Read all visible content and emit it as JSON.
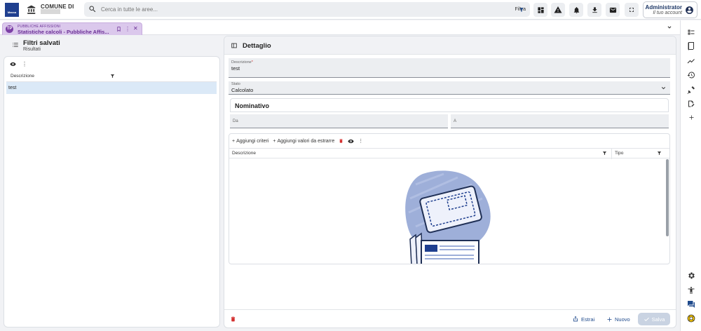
{
  "header": {
    "logo_text": "Massa",
    "comune_label": "COMUNE DI",
    "search_placeholder": "Cerca in tutte le aree...",
    "filter_label": "Filtra",
    "account_name": "Administrator",
    "account_sub": "Il tuo account"
  },
  "tab": {
    "badge": "TP",
    "category": "PUBBLICHE AFFISSIONI",
    "title": "Statistiche calcoli - Pubbliche Affis..."
  },
  "left_panel": {
    "title": "Filtri salvati",
    "subtitle": "Risultati",
    "column_header": "Descrizione",
    "rows": [
      "test"
    ]
  },
  "detail": {
    "title": "Dettaglio",
    "descrizione_label": "Descrizione",
    "required_mark": "*",
    "descrizione_value": "test",
    "stato_label": "Stato",
    "stato_value": "Calcolato",
    "nominativo_title": "Nominativo",
    "da_label": "Da",
    "a_label": "A",
    "add_criteri": "Aggiungi criteri",
    "add_valori": "Aggiungi valori da estrarre",
    "col_descrizione": "Descrizione",
    "col_tipo": "Tipo"
  },
  "footer": {
    "estrai": "Estrai",
    "nuovo": "Nuovo",
    "salva": "Salva"
  },
  "colors": {
    "accent": "#1f4a8c",
    "tab_bg": "#dbc8ec",
    "tab_text": "#6a2f95",
    "selected_row": "#dbe9f7",
    "danger": "#d32f2f"
  }
}
